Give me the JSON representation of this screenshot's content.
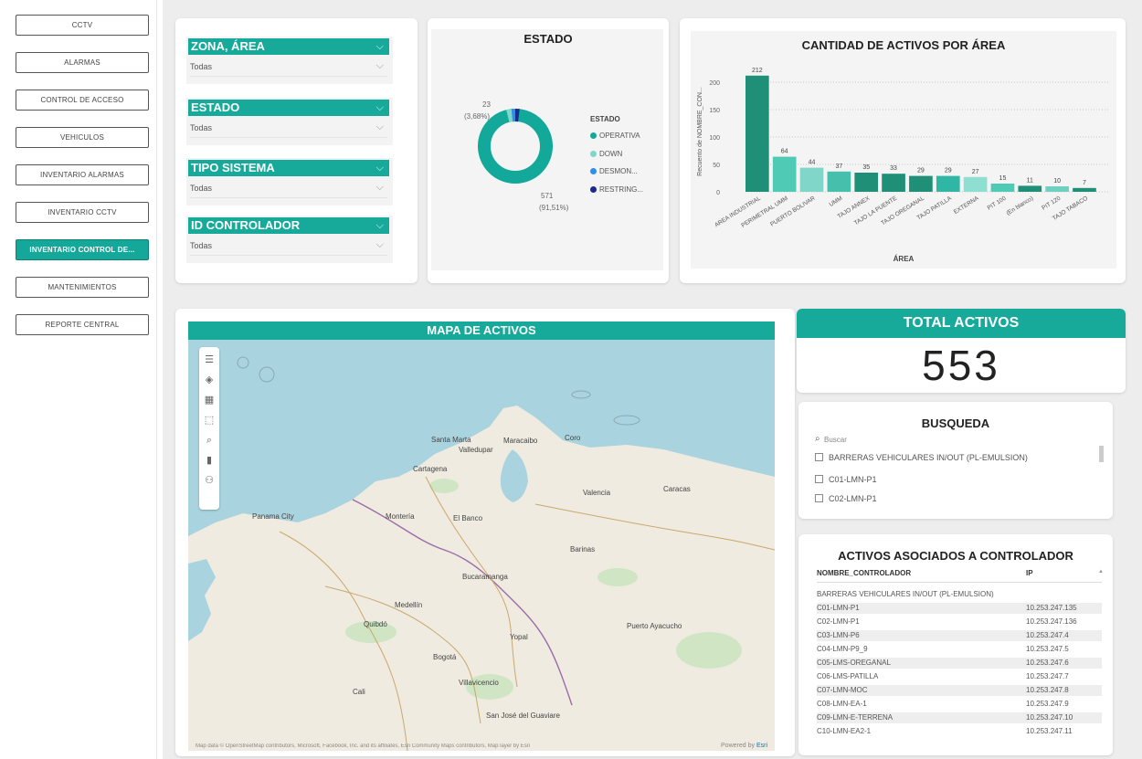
{
  "nav": {
    "items": [
      "CCTV",
      "ALARMAS",
      "CONTROL DE ACCESO",
      "VEHICULOS",
      "INVENTARIO ALARMAS",
      "INVENTARIO CCTV",
      "INVENTARIO CONTROL DE...",
      "MANTENIMIENTOS",
      "REPORTE CENTRAL"
    ],
    "active_index": 6
  },
  "filters": [
    {
      "label": "ZONA, ÁREA",
      "value": "Todas"
    },
    {
      "label": "ESTADO",
      "value": "Todas"
    },
    {
      "label": "TIPO SISTEMA",
      "value": "Todas"
    },
    {
      "label": "ID CONTROLADOR",
      "value": "Todas"
    }
  ],
  "estado": {
    "title": "ESTADO",
    "legend_title": "ESTADO",
    "legend": [
      "OPERATIVA",
      "DOWN",
      "DESMON...",
      "RESTRING..."
    ],
    "label_small_value": "23",
    "label_small_pct": "(3,68%)",
    "label_big_value": "571",
    "label_big_pct": "(91,51%)",
    "colors": [
      "#12a89a",
      "#7fd6c9",
      "#2e8fe8",
      "#1a2a8f"
    ]
  },
  "chart_data": {
    "type": "bar",
    "title": "CANTIDAD DE ACTIVOS POR ÁREA",
    "xlabel": "ÁREA",
    "ylabel": "Recuento de NOMBRE_CON...",
    "ylim": [
      0,
      220
    ],
    "yticks": [
      0,
      50,
      100,
      150,
      200
    ],
    "categories": [
      "AREA INDUSTRIAL",
      "PERIMETRAL UMM",
      "PUERTO BOLIVAR",
      "UMM",
      "TAJO ANNEX",
      "TAJO LA PUENTE",
      "TAJO OREGANAL",
      "TAJO PATILLA",
      "EXTERNA",
      "PIT 100",
      "(En blanco)",
      "PIT 120",
      "TAJO TABACO"
    ],
    "values": [
      212,
      64,
      44,
      37,
      35,
      33,
      29,
      29,
      27,
      15,
      11,
      10,
      7
    ],
    "colors": [
      "#1f8f78",
      "#4fcab5",
      "#7fd6c9",
      "#46c0ac",
      "#1f8f78",
      "#1f8f78",
      "#1f8f78",
      "#2fb6a4",
      "#8fded2",
      "#4fcab5",
      "#1f8f78",
      "#6fd0c2",
      "#1f8f78"
    ]
  },
  "map": {
    "title": "MAPA DE ACTIVOS",
    "attribution": "Map data © OpenStreetMap contributors, Microsoft, Facebook, Inc. and its affiliates, Esri Community Maps contributors, Map layer by Esri",
    "powered_by": "Powered by",
    "powered_by_brand": "Esri",
    "places": [
      "Santa Marta",
      "Cartagena",
      "Valledupar",
      "Maracaibo",
      "Coro",
      "Montería",
      "El Banco",
      "Panama City",
      "Medellín",
      "Bucaramanga",
      "Bogotá",
      "Quibdó",
      "Cali",
      "Valencia",
      "Caracas",
      "Barinas",
      "Puerto Ayacucho",
      "Yopal",
      "Villavicencio",
      "San José del Guaviare"
    ]
  },
  "total": {
    "title": "TOTAL ACTIVOS",
    "value": "553"
  },
  "busqueda": {
    "title": "BUSQUEDA",
    "placeholder": "Buscar",
    "items": [
      "BARRERAS VEHICULARES IN/OUT (PL-EMULSION)",
      "C01-LMN-P1",
      "C02-LMN-P1"
    ]
  },
  "activos": {
    "title": "ACTIVOS ASOCIADOS A CONTROLADOR",
    "col_name": "NOMBRE_CONTROLADOR",
    "col_ip": "IP",
    "rows": [
      {
        "name": "BARRERAS VEHICULARES IN/OUT (PL-EMULSION)",
        "ip": ""
      },
      {
        "name": "C01-LMN-P1",
        "ip": "10.253.247.135"
      },
      {
        "name": "C02-LMN-P1",
        "ip": "10.253.247.136"
      },
      {
        "name": "C03-LMN-P6",
        "ip": "10.253.247.4"
      },
      {
        "name": "C04-LMN-P9_9",
        "ip": "10.253.247.5"
      },
      {
        "name": "C05-LMS-OREGANAL",
        "ip": "10.253.247.6"
      },
      {
        "name": "C06-LMS-PATILLA",
        "ip": "10.253.247.7"
      },
      {
        "name": "C07-LMN-MOC",
        "ip": "10.253.247.8"
      },
      {
        "name": "C08-LMN-EA-1",
        "ip": "10.253.247.9"
      },
      {
        "name": "C09-LMN-E-TERRENA",
        "ip": "10.253.247.10"
      },
      {
        "name": "C10-LMN-EA2-1",
        "ip": "10.253.247.11"
      }
    ]
  }
}
